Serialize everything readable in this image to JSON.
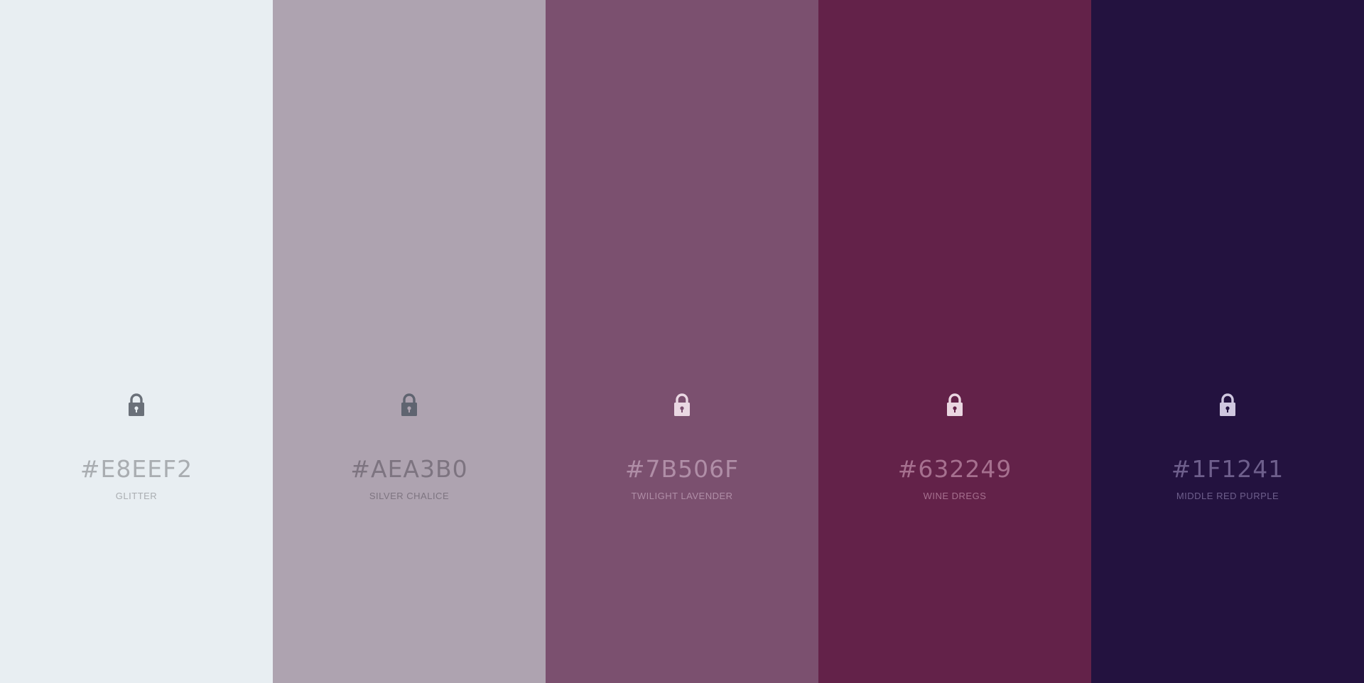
{
  "palette": {
    "swatches": [
      {
        "hex": "#E8EEF2",
        "name": "GLITTER",
        "background": "#e8eef2",
        "text_color": "#a9adb1",
        "lock_color": "#6a7079",
        "lock_hole_color": "#e8eef2",
        "icon": "lock-icon"
      },
      {
        "hex": "#AEA3B0",
        "name": "SILVER CHALICE",
        "background": "#aea3b0",
        "text_color": "#7d7480",
        "lock_color": "#5f6470",
        "lock_hole_color": "#aea3b0",
        "icon": "lock-icon"
      },
      {
        "hex": "#7B506F",
        "name": "TWILIGHT LAVENDER",
        "background": "#7b506f",
        "text_color": "#b08ea7",
        "lock_color": "#ead8e3",
        "lock_hole_color": "#7b506f",
        "icon": "lock-icon"
      },
      {
        "hex": "#632249",
        "name": "WINE DREGS",
        "background": "#632249",
        "text_color": "#a6708f",
        "lock_color": "#ead6e1",
        "lock_hole_color": "#632249",
        "icon": "lock-icon"
      },
      {
        "hex": "#1F1241",
        "name": "MIDDLE RED PURPLE",
        "background": "#23123f",
        "text_color": "#6e5f8c",
        "lock_color": "#cfc7df",
        "lock_hole_color": "#23123f",
        "icon": "lock-icon"
      }
    ]
  }
}
